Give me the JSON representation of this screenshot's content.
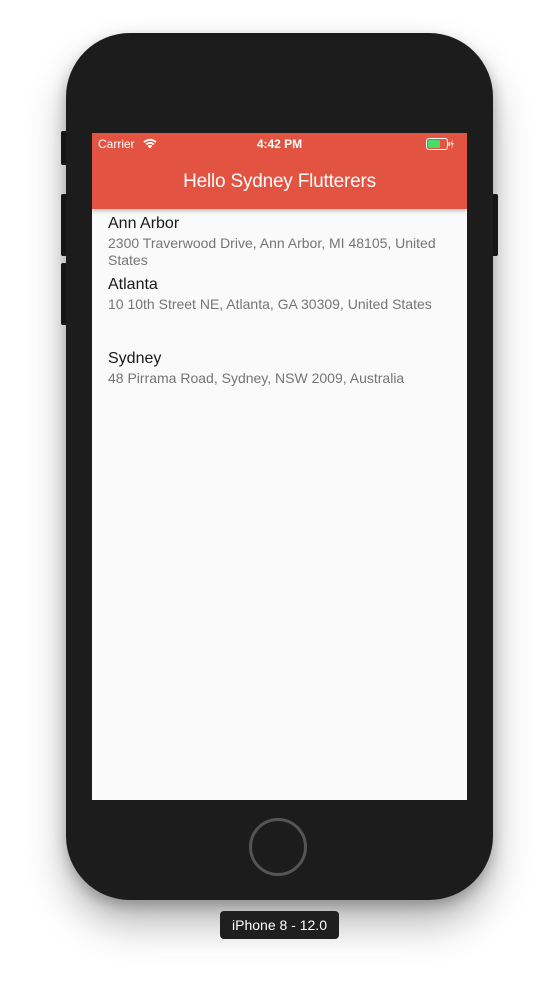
{
  "device": {
    "label": "iPhone 8 - 12.0"
  },
  "status_bar": {
    "carrier": "Carrier",
    "time": "4:42 PM",
    "icons": [
      "wifi-icon",
      "battery-charging-icon"
    ],
    "battery_color": "#4cd964"
  },
  "app_bar": {
    "title": "Hello Sydney Flutterers",
    "color": "#e35341"
  },
  "locations": [
    {
      "name": "Ann Arbor",
      "address": "2300 Traverwood Drive, Ann Arbor, MI 48105, United States"
    },
    {
      "name": "Atlanta",
      "address": "10 10th Street NE, Atlanta, GA 30309, United States"
    },
    {
      "name": "Sydney",
      "address": "48 Pirrama Road, Sydney, NSW 2009, Australia"
    }
  ]
}
